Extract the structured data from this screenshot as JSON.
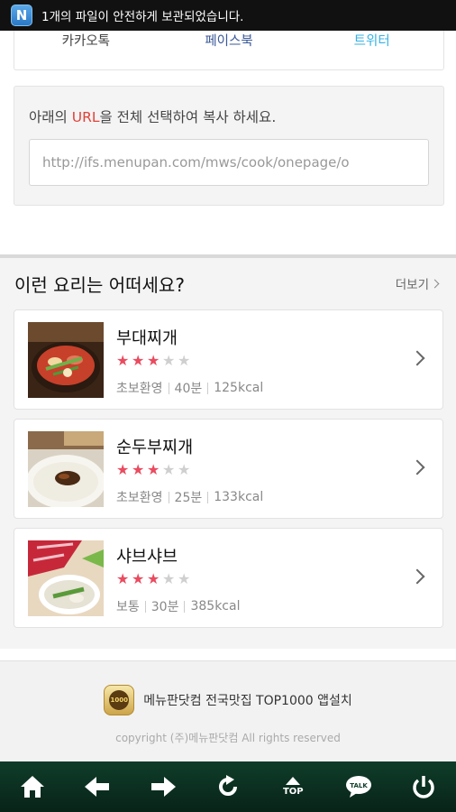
{
  "status_bar": {
    "app_letter": "N",
    "notification": "1개의 파일이 안전하게 보관되었습니다."
  },
  "share": {
    "kakao": "카카오톡",
    "facebook": "페이스북",
    "twitter": "트위터"
  },
  "url_box": {
    "instruction_before": "아래의 ",
    "instruction_highlight": "URL",
    "instruction_after": "을 전체 선택하여 복사 하세요.",
    "url_value": "http://ifs.menupan.com/mws/cook/onepage/o"
  },
  "recommend": {
    "title": "이런 요리는 어떠세요?",
    "more_label": "더보기",
    "items": [
      {
        "name": "부대찌개",
        "rating": 3,
        "max_rating": 5,
        "level": "초보환영",
        "time": "40분",
        "calories": "125kcal"
      },
      {
        "name": "순두부찌개",
        "rating": 3,
        "max_rating": 5,
        "level": "초보환영",
        "time": "25분",
        "calories": "133kcal"
      },
      {
        "name": "샤브샤브",
        "rating": 3,
        "max_rating": 5,
        "level": "보통",
        "time": "30분",
        "calories": "385kcal"
      }
    ]
  },
  "footer": {
    "badge_text": "1000",
    "install_text": "메뉴판닷컴 전국맛집 TOP1000 앱설치",
    "copyright": "copyright (주)메뉴판닷컴 All rights reserved"
  },
  "nav": {
    "top_label": "TOP",
    "talk_label": "TALK"
  },
  "colors": {
    "accent_red": "#e1413a",
    "star_on": "#e94b5f",
    "nav_bg": "#0f3d2a"
  }
}
